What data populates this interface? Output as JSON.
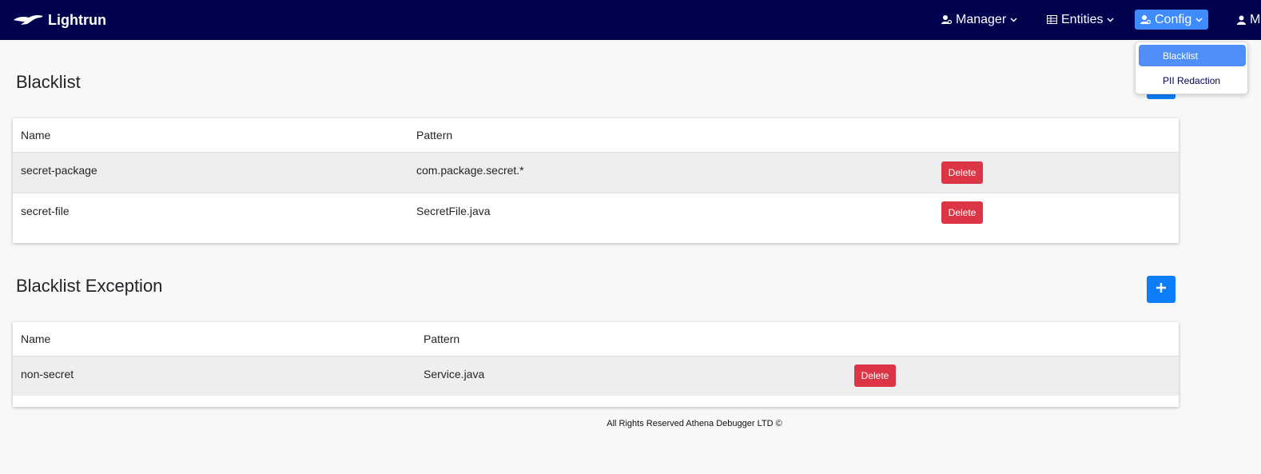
{
  "brand": {
    "name": "Lightrun",
    "logo_icon": "cheetah-icon"
  },
  "nav": {
    "manager": {
      "label": "Manager",
      "icon": "user-cog-icon"
    },
    "entities": {
      "label": "Entities",
      "icon": "table-icon"
    },
    "config": {
      "label": "Config",
      "icon": "user-cog-icon"
    },
    "user": {
      "label": "M",
      "icon": "user-icon"
    }
  },
  "config_menu": {
    "items": [
      {
        "label": "Blacklist",
        "selected": true
      },
      {
        "label": "PII Redaction",
        "selected": false
      }
    ]
  },
  "blacklist": {
    "title": "Blacklist",
    "headers": {
      "name": "Name",
      "pattern": "Pattern"
    },
    "rows": [
      {
        "name": "secret-package",
        "pattern": "com.package.secret.*",
        "action": "Delete"
      },
      {
        "name": "secret-file",
        "pattern": "SecretFile.java",
        "action": "Delete"
      }
    ]
  },
  "blacklist_exception": {
    "title": "Blacklist Exception",
    "headers": {
      "name": "Name",
      "pattern": "Pattern"
    },
    "rows": [
      {
        "name": "non-secret",
        "pattern": "Service.java",
        "action": "Delete"
      }
    ]
  },
  "footer": {
    "text": "All Rights Reserved Athena Debugger LTD ©"
  },
  "colors": {
    "navbar": "#01024e",
    "accent": "#0d7ef7",
    "danger": "#dc3545",
    "menu_selected": "#4f8ff7"
  }
}
